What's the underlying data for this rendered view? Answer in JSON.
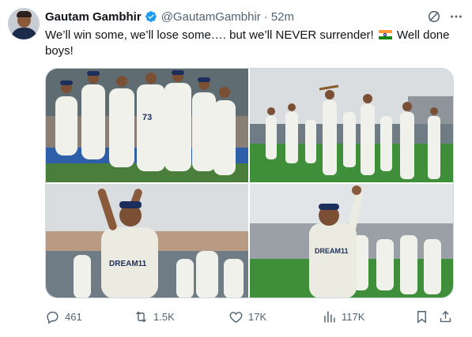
{
  "tweet": {
    "author_name": "Gautam Gambhir",
    "handle": "@GautamGambhir",
    "separator": "·",
    "time": "52m",
    "text_before_flag": "We’ll win some, we’ll lose some…. but we’ll NEVER surrender!",
    "flag_emoji": "india-flag",
    "text_after_flag": "Well done boys!",
    "jersey_text_a": "DREAM11",
    "jersey_number": "73"
  },
  "stats": {
    "replies": "461",
    "reposts": "1.5K",
    "likes": "17K",
    "views": "117K"
  },
  "icons": {
    "verified": "verified-badge-icon",
    "grok": "grok-icon",
    "more": "more-icon",
    "reply": "reply-icon",
    "repost": "repost-icon",
    "like": "like-icon",
    "views": "views-icon",
    "bookmark": "bookmark-icon",
    "share": "share-icon"
  },
  "colors": {
    "verified_blue": "#1d9bf0",
    "text_primary": "#0f1419",
    "text_secondary": "#536471",
    "border": "#cfd9de",
    "pitch_green": "#3f8f3a",
    "kit_white": "#f1f1ec"
  }
}
